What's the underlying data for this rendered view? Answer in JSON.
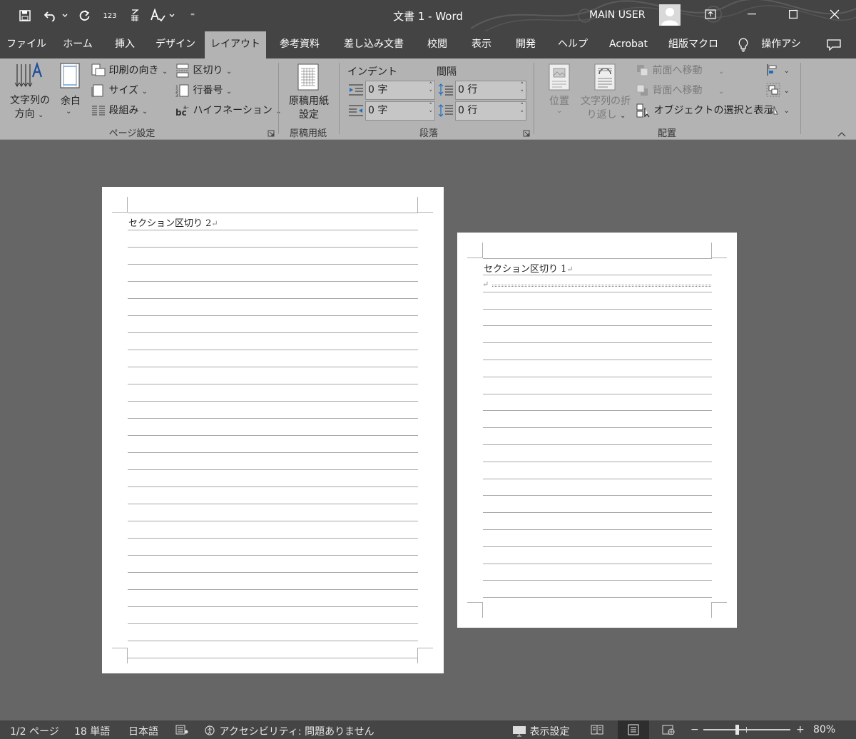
{
  "title_bar": {
    "document_title": "文書 1  -  Word",
    "user_name": "MAIN USER",
    "qat_number_label": "123",
    "qat_more": "⁼"
  },
  "tabs": [
    {
      "label": "ファイル",
      "active": false
    },
    {
      "label": "ホーム",
      "active": false
    },
    {
      "label": "挿入",
      "active": false
    },
    {
      "label": "デザイン",
      "active": false
    },
    {
      "label": "レイアウト",
      "active": true
    },
    {
      "label": "参考資料",
      "active": false
    },
    {
      "label": "差し込み文書",
      "active": false
    },
    {
      "label": "校閲",
      "active": false
    },
    {
      "label": "表示",
      "active": false
    },
    {
      "label": "開発",
      "active": false
    },
    {
      "label": "ヘルプ",
      "active": false
    },
    {
      "label": "Acrobat",
      "active": false
    },
    {
      "label": "組版マクロ",
      "active": false
    },
    {
      "label": "操作アシ",
      "active": false
    }
  ],
  "ribbon": {
    "page_setup": {
      "text_direction_line1": "文字列の",
      "text_direction_line2": "方向",
      "margins": "余白",
      "orientation": "印刷の向き",
      "size": "サイズ",
      "columns": "段組み",
      "breaks": "区切り",
      "line_numbers": "行番号",
      "hyphenation": "ハイフネーション",
      "group_label": "ページ設定"
    },
    "genko": {
      "button_line1": "原稿用紙",
      "button_line2": "設定",
      "group_label": "原稿用紙"
    },
    "paragraph": {
      "indent_label": "インデント",
      "spacing_label": "間隔",
      "indent_left": "0 字",
      "indent_right": "0 字",
      "spacing_before": "0 行",
      "spacing_after": "0 行",
      "group_label": "段落"
    },
    "arrange": {
      "position": "位置",
      "wrap_line1": "文字列の折",
      "wrap_line2": "り返し",
      "bring_forward": "前面へ移動",
      "send_backward": "背面へ移動",
      "selection_pane": "オブジェクトの選択と表示",
      "group_label": "配置"
    }
  },
  "document": {
    "page1_text": "セクション区切り 2",
    "page2_text": "セクション区切り 1",
    "return_mark": "↵"
  },
  "status_bar": {
    "page": "1/2 ページ",
    "words": "18 単語",
    "language": "日本語",
    "accessibility": "アクセシビリティ: 問題ありません",
    "display_settings": "表示設定",
    "zoom": "80%",
    "zoom_level": 0.8,
    "zoom_minus": "−",
    "zoom_plus": "+"
  },
  "colors": {
    "title_bar_bg": "#444444",
    "ribbon_bg": "#b3b3b3",
    "workspace_bg": "#666666",
    "status_bar_bg": "#454545"
  }
}
